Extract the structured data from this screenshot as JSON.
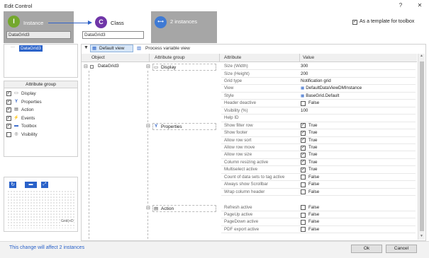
{
  "window": {
    "title": "Edit Control",
    "help": "?",
    "close": "✕"
  },
  "steps": {
    "instance": {
      "letter": "I",
      "label": "Instance",
      "value": "DataGrid3",
      "color": "#74a82d"
    },
    "class": {
      "letter": "C",
      "label": "Class",
      "value": "DataGrid3",
      "color": "#7036a8"
    },
    "instances": {
      "label": "2 instances",
      "color": "#3f7ad4"
    }
  },
  "template_checkbox": {
    "label": "As a template for toolbox",
    "checked": "✓"
  },
  "tree": {
    "selected": "DataGrid3"
  },
  "attr_groups": {
    "header": "Attribute group",
    "items": [
      {
        "label": "Display",
        "checked": "✓",
        "icon": "display-icon",
        "glyph": "▭"
      },
      {
        "label": "Properties",
        "checked": "✓",
        "icon": "properties-icon",
        "glyph": "Y"
      },
      {
        "label": "Action",
        "checked": "✓",
        "icon": "action-icon",
        "glyph": "▤"
      },
      {
        "label": "Events",
        "checked": "✓",
        "icon": "events-icon",
        "glyph": "⚡"
      },
      {
        "label": "Toolbox",
        "checked": "✓",
        "icon": "toolbox-icon",
        "glyph": "▬"
      },
      {
        "label": "Visibility",
        "checked": "",
        "icon": "visibility-icon",
        "glyph": "◎"
      }
    ]
  },
  "preview_tools": {
    "refresh": "↻",
    "display": "▬",
    "fit": "⤢",
    "component_label": "Grid(+D"
  },
  "views": {
    "default": "Default view",
    "process": "Process variable view"
  },
  "columns": {
    "object": "Object",
    "attribute_group": "Attribute group",
    "attribute": "Attribute",
    "value": "Value"
  },
  "object": {
    "name": "DataGrid3",
    "expander": "⊟"
  },
  "groups": [
    {
      "label": "Display",
      "expander": "⊟",
      "icon": "display-icon",
      "glyph": "▭"
    },
    {
      "label": "Properties",
      "expander": "⊟",
      "icon": "properties-icon",
      "glyph": "Y"
    },
    {
      "label": "Action",
      "expander": "⊟",
      "icon": "action-icon",
      "glyph": "▤"
    }
  ],
  "rows": [
    {
      "attribute": "Size (Width)",
      "value": "300"
    },
    {
      "attribute": "Size (Height)",
      "value": "200"
    },
    {
      "attribute": "Grid type",
      "value": "Notification grid"
    },
    {
      "attribute": "View",
      "value": "DefaultDataViewDMInstance"
    },
    {
      "attribute": "Style",
      "value": "BaseGrid.Default"
    },
    {
      "attribute": "Header deactive",
      "value": "False",
      "check": ""
    },
    {
      "attribute": "Visibility (%)",
      "value": "100"
    },
    {
      "attribute": "Help ID",
      "value": ""
    },
    {
      "attribute": "Show filter row",
      "value": "True",
      "check": "✓"
    },
    {
      "attribute": "Show footer",
      "value": "True",
      "check": "✓"
    },
    {
      "attribute": "Allow row sort",
      "value": "True",
      "check": "✓"
    },
    {
      "attribute": "Allow row move",
      "value": "True",
      "check": "✓"
    },
    {
      "attribute": "Allow row size",
      "value": "True",
      "check": "✓"
    },
    {
      "attribute": "Column resizing active",
      "value": "True",
      "check": "✓"
    },
    {
      "attribute": "Multiselect active",
      "value": "True",
      "check": "✓"
    },
    {
      "attribute": "Count of data sets to tag active",
      "value": "False",
      "check": ""
    },
    {
      "attribute": "Always show Scrollbar",
      "value": "False",
      "check": ""
    },
    {
      "attribute": "Wrap column header",
      "value": "False",
      "check": ""
    },
    {
      "attribute": "Refresh active",
      "value": "False",
      "check": ""
    },
    {
      "attribute": "PageUp active",
      "value": "False",
      "check": ""
    },
    {
      "attribute": "PageDown active",
      "value": "False",
      "check": ""
    },
    {
      "attribute": "PDF export active",
      "value": "False",
      "check": ""
    }
  ],
  "footer": {
    "message": "This change will affect 2 instances",
    "ok": "Ok",
    "cancel": "Cancel"
  }
}
